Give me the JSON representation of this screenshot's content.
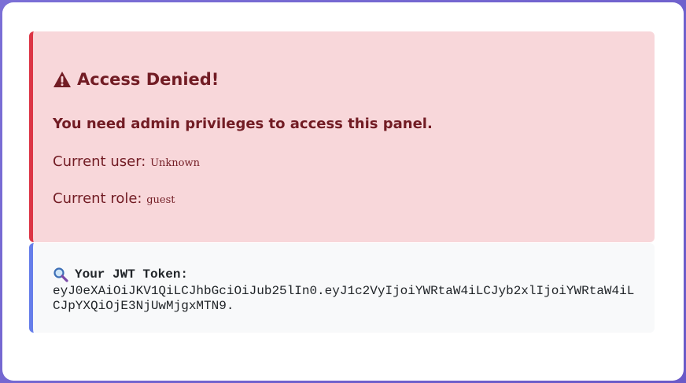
{
  "alert": {
    "title": "Access Denied!",
    "message": "You need admin privileges to access this panel.",
    "user_label": "Current user:",
    "user_value": "Unknown",
    "role_label": "Current role:",
    "role_value": "guest",
    "icon": "warning-icon",
    "bg_color": "#f8d7da",
    "border_color": "#dc3545",
    "text_color": "#721c24"
  },
  "token": {
    "icon": "magnifier-icon",
    "label": "Your JWT Token:",
    "value": "eyJ0eXAiOiJKV1QiLCJhbGciOiJub25lIn0.eyJ1c2VyIjoiYWRtaW4iLCJyb2xlIjoiYWRtaW4iLCJpYXQiOjE3NjUwMjgxMTN9.",
    "border_color": "#667eea"
  },
  "page": {
    "background": "#7b6fd6"
  }
}
